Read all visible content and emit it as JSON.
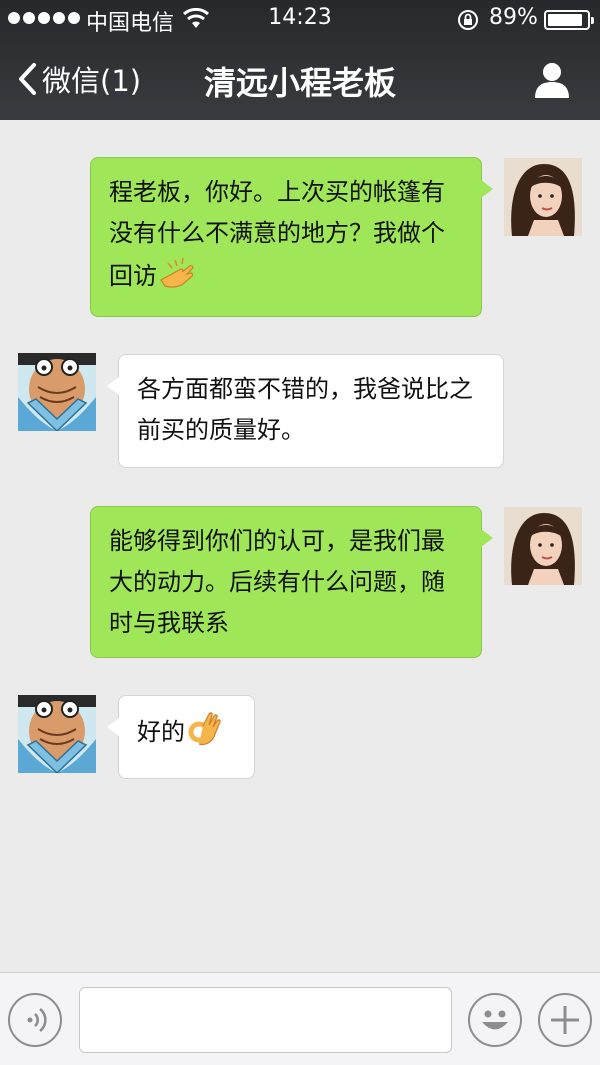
{
  "status_bar": {
    "carrier": "中国电信",
    "time": "14:23",
    "battery_percent": "89%",
    "battery_level": 0.89,
    "signal_bars": 5
  },
  "nav": {
    "back_label": "微信(1)",
    "title": "清远小程老板"
  },
  "messages": [
    {
      "side": "sent",
      "text": "程老板，你好。上次买的帐篷有没有什么不满意的地方？我做个回访",
      "emoji": "pointing-hand-emoji"
    },
    {
      "side": "received",
      "text": "各方面都蛮不错的，我爸说比之前买的质量好。"
    },
    {
      "side": "sent",
      "text": "能够得到你们的认可，是我们最大的动力。后续有什么问题，随时与我联系"
    },
    {
      "side": "received",
      "text": "好的",
      "emoji": "ok-hand-emoji"
    }
  ],
  "colors": {
    "sent_bubble": "#9fe658",
    "received_bubble": "#ffffff",
    "chat_background": "#ebebeb",
    "header": "#2f3035"
  }
}
